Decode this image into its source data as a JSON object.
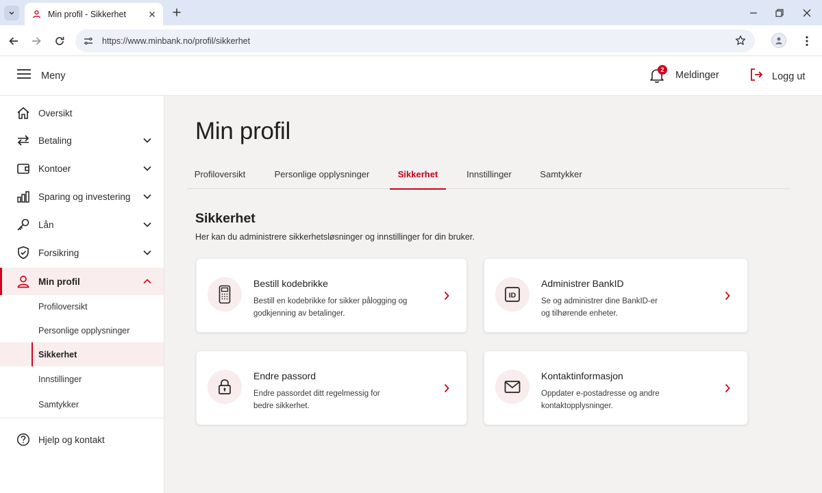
{
  "browser": {
    "tab_title": "Min profil - Sikkerhet",
    "url": "https://www.minbank.no/profil/sikkerhet",
    "icons": [
      "tab-search-icon",
      "bank-favicon-icon",
      "close-icon",
      "plus-icon",
      "minimize-icon",
      "restore-icon",
      "close-window-icon",
      "back-icon",
      "forward-icon",
      "reload-icon",
      "site-settings-icon",
      "star-icon",
      "profile-icon",
      "kebab-icon"
    ]
  },
  "header": {
    "menu_label": "Meny",
    "notifications_label": "Meldinger",
    "notification_count": "2",
    "logout_label": "Logg ut"
  },
  "sidebar": {
    "items": [
      {
        "label": "Oversikt",
        "icon": "home-icon"
      },
      {
        "label": "Betaling",
        "icon": "transfer-icon"
      },
      {
        "label": "Kontoer",
        "icon": "wallet-icon"
      },
      {
        "label": "Sparing og investering",
        "icon": "bar-chart-icon"
      },
      {
        "label": "Lån",
        "icon": "key-icon"
      },
      {
        "label": "Forsikring",
        "icon": "shield-icon"
      },
      {
        "label": "Min profil",
        "icon": "user-icon"
      }
    ],
    "subitems": [
      {
        "label": "Profiloversikt"
      },
      {
        "label": "Personlige opplysninger"
      },
      {
        "label": "Sikkerhet"
      },
      {
        "label": "Innstillinger"
      },
      {
        "label": "Samtykker"
      }
    ],
    "help_label": "Hjelp og kontakt"
  },
  "main": {
    "page_title": "Min profil",
    "tabs": [
      {
        "label": "Profiloversikt"
      },
      {
        "label": "Personlige opplysninger"
      },
      {
        "label": "Sikkerhet"
      },
      {
        "label": "Innstillinger"
      },
      {
        "label": "Samtykker"
      }
    ],
    "section_title": "Sikkerhet",
    "section_desc": "Her kan du administrere sikkerhetsløsninger og innstillinger for din bruker.",
    "cards": [
      {
        "title": "Bestill kodebrikke",
        "desc_line1": "Bestill en kodebrikke for sikker pålogging og",
        "desc_line2": "godkjenning av betalinger.",
        "icon": "code-device-icon"
      },
      {
        "title": "Administrer BankID",
        "desc_line1": "Se og administrer dine BankID-er",
        "desc_line2": "og tilhørende enheter.",
        "icon": "id-card-icon"
      },
      {
        "title": "Endre passord",
        "desc_line1": "Endre passordet ditt regelmessig for",
        "desc_line2": "bedre sikkerhet.",
        "icon": "lock-icon"
      },
      {
        "title": "Kontaktinformasjon",
        "desc_line1": "Oppdater e-postadresse og andre",
        "desc_line2": "kontaktopplysninger.",
        "icon": "envelope-icon"
      }
    ]
  },
  "colors": {
    "accent": "#d0021b",
    "main_background": "#f3f2f1",
    "active_background": "#f9eded",
    "icon_circle": "#f8ecec",
    "tabstrip": "#dfe6f5"
  }
}
